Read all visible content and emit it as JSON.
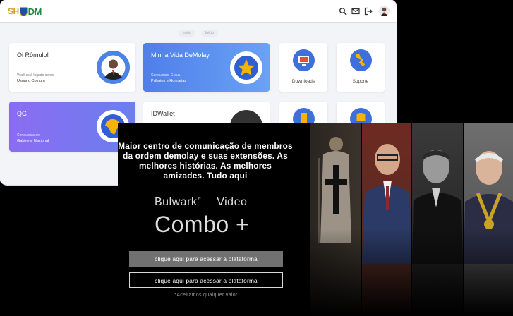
{
  "app": {
    "logo_text_1": "SH",
    "logo_text_2": "DM",
    "breadcrumbs": [
      "Início",
      "Início"
    ],
    "cards": {
      "greeting": {
        "title": "Oi Rômulo!",
        "line1": "Você está logado como",
        "line2": "Usuário Comum"
      },
      "minha_vida": {
        "title": "Minha Vida DeMolay",
        "line1": "Conquistas, Graus",
        "line2": "Prêmios e Honrarias"
      },
      "downloads": {
        "label": "Downloads"
      },
      "suporte": {
        "label": "Suporte"
      },
      "qg": {
        "title": "QG",
        "line1": "Conquistas do",
        "line2": "Gabinete Nacional"
      },
      "idwallet": {
        "title": "IDWallet"
      }
    },
    "icons": [
      "search-icon",
      "mail-icon",
      "logout-icon",
      "avatar"
    ]
  },
  "promo": {
    "headline": "Maior centro de comunicação de membros da ordem demolay e suas extensões. As melhores histórias. As melhores amizades. Tudo aqui",
    "brand": "Bulwark”",
    "brand_suffix": "Video",
    "product": "Combo +",
    "cta_primary": "clique aqui para acessar a plataforma",
    "cta_secondary": "clique aqui para acessar a plataforma",
    "note": "*Aceitamos qualquer valor"
  },
  "colors": {
    "blue_card": "#4f7fe8",
    "purple_card": "#8b6cf0",
    "accent_yellow": "#f4b400",
    "button_grey": "#717171"
  }
}
